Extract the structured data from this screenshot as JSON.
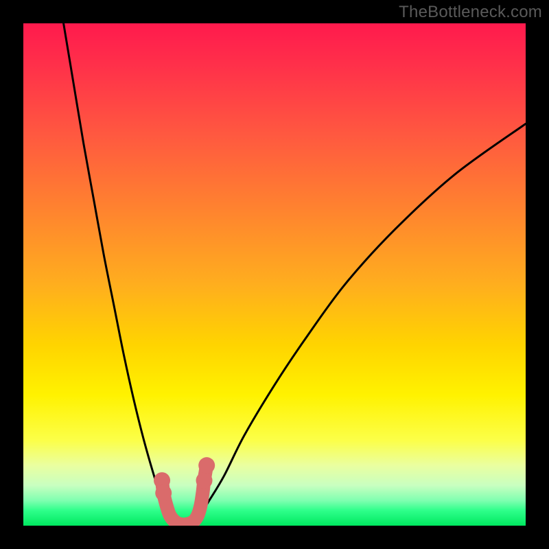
{
  "watermark": "TheBottleneck.com",
  "chart_data": {
    "type": "line",
    "title": "",
    "xlabel": "",
    "ylabel": "",
    "xlim": [
      0,
      100
    ],
    "ylim": [
      0,
      100
    ],
    "series": [
      {
        "name": "left-curve",
        "x": [
          8,
          10,
          12,
          14,
          16,
          18,
          20,
          22,
          24,
          26,
          27,
          28,
          29,
          30,
          31,
          32
        ],
        "y": [
          100,
          88,
          76,
          65,
          54,
          44,
          34,
          25,
          17,
          10,
          7,
          5,
          3,
          1.5,
          0.7,
          0
        ]
      },
      {
        "name": "right-curve",
        "x": [
          32,
          33,
          34,
          35,
          37,
          40,
          44,
          50,
          56,
          64,
          74,
          86,
          100
        ],
        "y": [
          0,
          0.3,
          1,
          2,
          5,
          10,
          18,
          28,
          37,
          48,
          59,
          70,
          80
        ]
      },
      {
        "name": "valley-markers",
        "x": [
          27.6,
          27.9,
          28.5,
          29.2,
          30.2,
          31.3,
          32.5,
          33.8,
          34.7,
          35.3,
          35.7,
          36.0,
          36.5
        ],
        "y": [
          9.0,
          6.5,
          4.0,
          2.0,
          0.8,
          0.3,
          0.3,
          0.8,
          2.0,
          4.0,
          6.5,
          9.0,
          12.0
        ]
      }
    ],
    "annotations": []
  }
}
